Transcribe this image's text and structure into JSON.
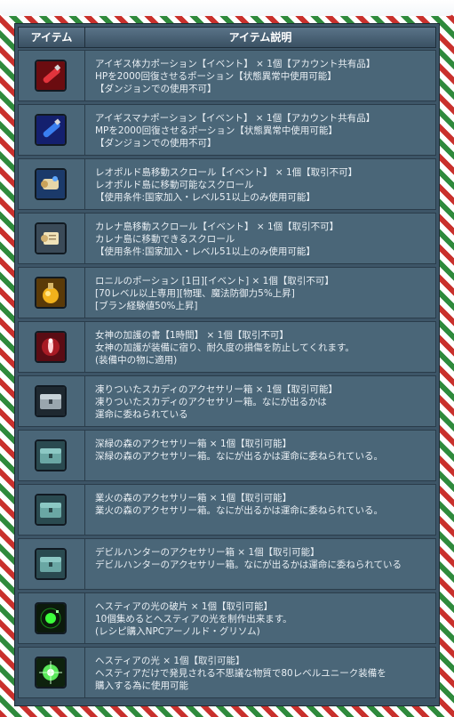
{
  "header": {
    "col_item": "アイテム",
    "col_desc": "アイテム説明"
  },
  "items": [
    {
      "icon": "potion-red-icon",
      "lines": [
        "アイギス体力ポーション【イベント】 × 1個【アカウント共有品】",
        "HPを2000回復させるポーション【状態異常中使用可能】",
        "【ダンジョンでの使用不可】"
      ]
    },
    {
      "icon": "potion-blue-icon",
      "lines": [
        "アイギスマナポーション【イベント】 × 1個【アカウント共有品】",
        "MPを2000回復させるポーション【状態異常中使用可能】",
        "【ダンジョンでの使用不可】"
      ]
    },
    {
      "icon": "scroll-blue-icon",
      "lines": [
        "レオポルド島移動スクロール【イベント】 × 1個【取引不可】",
        "レオポルド島に移動可能なスクロール",
        "【使用条件:国家加入・レベル51以上のみ使用可能】"
      ]
    },
    {
      "icon": "scroll-paper-icon",
      "lines": [
        "カレナ島移動スクロール【イベント】 × 1個【取引不可】",
        "カレナ島に移動できるスクロール",
        "【使用条件:国家加入・レベル51以上のみ使用可能】"
      ]
    },
    {
      "icon": "potion-gold-icon",
      "lines": [
        "ロニルのポーション [1日][イベント] × 1個【取引不可】",
        "[70レベル以上専用][物理、魔法防御力5%上昇]",
        "[ブラン経験値50%上昇]"
      ]
    },
    {
      "icon": "goddess-book-icon",
      "lines": [
        "女神の加護の書【1時間】 × 1個【取引不可】",
        "女神の加護が装備に宿り、耐久度の損傷を防止してくれます。",
        "(装備中の物に適用)"
      ]
    },
    {
      "icon": "frozen-chest-icon",
      "lines": [
        "凍りついたスカディのアクセサリー箱 × 1個【取引可能】",
        "凍りついたスカディのアクセサリー箱。なにが出るかは",
        "運命に委ねられている"
      ]
    },
    {
      "icon": "chest-teal-icon",
      "lines": [
        "深緑の森のアクセサリー箱 × 1個【取引可能】",
        "深緑の森のアクセサリー箱。なにが出るかは運命に委ねられている。"
      ]
    },
    {
      "icon": "chest-teal-icon",
      "lines": [
        "業火の森のアクセサリー箱 × 1個【取引可能】",
        "業火の森のアクセサリー箱。なにが出るかは運命に委ねられている。"
      ]
    },
    {
      "icon": "chest-teal-icon",
      "lines": [
        "デビルハンターのアクセサリー箱 × 1個【取引可能】",
        "デビルハンターのアクセサリー箱。なにが出るかは運命に委ねられている"
      ]
    },
    {
      "icon": "light-shard-icon",
      "lines": [
        "ヘスティアの光の破片 × 1個【取引可能】",
        "10個集めるとヘスティアの光を制作出来ます。",
        "(レシピ購入NPCアーノルド・グリソム)"
      ]
    },
    {
      "icon": "light-orb-icon",
      "lines": [
        "ヘスティアの光 × 1個【取引可能】",
        "ヘスティアだけで発見される不思議な物質で80レベルユニーク装備を",
        "購入する為に使用可能"
      ]
    }
  ]
}
